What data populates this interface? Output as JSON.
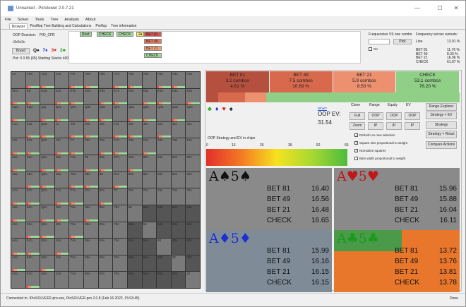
{
  "window": {
    "title": "Unnamed - PioViewer 2.0.7.21"
  },
  "menu": [
    "File",
    "Solver",
    "Tools",
    "Tree",
    "Analysis",
    "About"
  ],
  "tabs": [
    "Browser",
    "Postflop Tree Building and Calculations",
    "Preflop",
    "Tree information"
  ],
  "decision": {
    "label": "OOP Decision:",
    "node": "PIO_CFR"
  },
  "board": {
    "cards": "r3c5c3c",
    "button": "Board",
    "dealt": [
      {
        "card": "Q",
        "suit": "♠",
        "color": "#111"
      },
      {
        "card": "7",
        "suit": "♦",
        "color": "#2030d0"
      },
      {
        "card": "3",
        "suit": "♥",
        "color": "#d02020"
      },
      {
        "card": "2",
        "suit": "♣",
        "color": "#20a020"
      }
    ],
    "pot": "Pot: 0 0 65 (65) Starting Stacks 400"
  },
  "action_line": {
    "items": [
      {
        "label": "Root",
        "color": "#9fd89a"
      },
      {
        "label": "CHECK",
        "color": "#9fd89a"
      },
      {
        "label": "CHECK",
        "color": "#9fd89a"
      },
      {
        "label": "2♦",
        "color": "#f5e46a"
      }
    ],
    "options": [
      {
        "label": "BET 81",
        "color": "#d9534f"
      },
      {
        "label": "BET 49",
        "color": "#e8775a"
      },
      {
        "label": "BET 21",
        "color": "#f0a07a"
      },
      {
        "label": "CHECK",
        "color": "#9fd89a"
      }
    ]
  },
  "frequencies_combo": {
    "title": "Frequencies VS one combo",
    "pick_button": "Pick",
    "on_label": "On"
  },
  "frequencies_runouts": {
    "title": "Frequency across runouts:",
    "line_label": "Line",
    "line_value": "13.91 %",
    "rows": [
      {
        "label": "BET 81",
        "value": "11.76 %"
      },
      {
        "label": "BET 49",
        "value": "8.30 %"
      },
      {
        "label": "BET 21",
        "value": "16.96 %"
      },
      {
        "label": "CHECK",
        "value": "61.97 %"
      }
    ]
  },
  "grid": {
    "ranks": [
      "A",
      "K",
      "Q",
      "J",
      "T",
      "9",
      "8",
      "7",
      "6",
      "5",
      "4",
      "3",
      "2"
    ]
  },
  "strategy_bars": [
    {
      "action": "BET 81",
      "combos": "3.2 combos",
      "pct": "4.61 %",
      "color": "#b5503e",
      "frac": 0.0461
    },
    {
      "action": "BET 49",
      "combos": "7.5 combos",
      "pct": "10.69 %",
      "color": "#d8694c",
      "frac": 0.1069
    },
    {
      "action": "BET 21",
      "combos": "5.9 combos",
      "pct": "8.50 %",
      "color": "#ec9070",
      "frac": 0.085
    },
    {
      "action": "CHECK",
      "combos": "53.1 combos",
      "pct": "76.20 %",
      "color": "#8fcf86",
      "frac": 0.762
    }
  ],
  "suits": [
    {
      "glyph": "♣",
      "color": "#20a020"
    },
    {
      "glyph": "♦",
      "color": "#2030d0"
    },
    {
      "glyph": "♥",
      "color": "#d02020"
    },
    {
      "glyph": "♠",
      "color": "#111"
    }
  ],
  "ev": {
    "link": "What?",
    "label": "OOP EV:",
    "value": "31.54"
  },
  "controls": {
    "headers": [
      "Clone",
      "Range",
      "Equity",
      "EV"
    ],
    "buttons_row1": [
      "Full",
      "OOP",
      "OOP",
      "OOP"
    ],
    "buttons_row2": [
      "Zoom",
      "IP",
      "IP",
      "IP"
    ],
    "right_buttons": [
      "Range Explorer",
      "Strategy + EV",
      "Strategy",
      "Strategy + React",
      "Compare Actions"
    ]
  },
  "options": [
    {
      "label": "Refresh on new selection",
      "checked": true
    },
    {
      "label": "Square size proportional to weight",
      "checked": true
    },
    {
      "label": "Normalize squares",
      "checked": true
    },
    {
      "label": "Bars width proportional to weight",
      "checked": false
    }
  ],
  "scale": {
    "caption": "OOP Strategy and EV in chips",
    "ticks": [
      "0",
      "13",
      "26",
      "39",
      "52",
      "65"
    ]
  },
  "combos": [
    {
      "rank1": "A",
      "suit1": "♠",
      "rank2": "5",
      "suit2": "♠",
      "color": "#111",
      "rows": [
        [
          "BET 81",
          "16.40"
        ],
        [
          "BET 49",
          "16.56"
        ],
        [
          "BET 21",
          "16.48"
        ],
        [
          "CHECK",
          "16.65"
        ]
      ]
    },
    {
      "rank1": "A",
      "suit1": "♥",
      "rank2": "5",
      "suit2": "♥",
      "color": "#c01818",
      "rows": [
        [
          "BET 81",
          "15.96"
        ],
        [
          "BET 49",
          "15.88"
        ],
        [
          "BET 21",
          "16.04"
        ],
        [
          "CHECK",
          "16.11"
        ]
      ]
    },
    {
      "rank1": "A",
      "suit1": "♦",
      "rank2": "5",
      "suit2": "♦",
      "color": "#1a30d0",
      "rows": [
        [
          "BET 81",
          "15.99"
        ],
        [
          "BET 49",
          "16.16"
        ],
        [
          "BET 21",
          "16.15"
        ],
        [
          "CHECK",
          "16.15"
        ]
      ]
    },
    {
      "rank1": "A",
      "suit1": "♣",
      "rank2": "5",
      "suit2": "♣",
      "color": "#1a9a1a",
      "rows": [
        [
          "BET 81",
          "13.72"
        ],
        [
          "BET 49",
          "13.76"
        ],
        [
          "BET 21",
          "13.81"
        ],
        [
          "CHECK",
          "13.78"
        ]
      ]
    }
  ],
  "status": {
    "left": "Connected to .\\PioSOLVER2-pro.exe, PioSOLVER-pro 2.0.8 (Feb 16 2022, 15:03:45)",
    "right": "Done"
  }
}
